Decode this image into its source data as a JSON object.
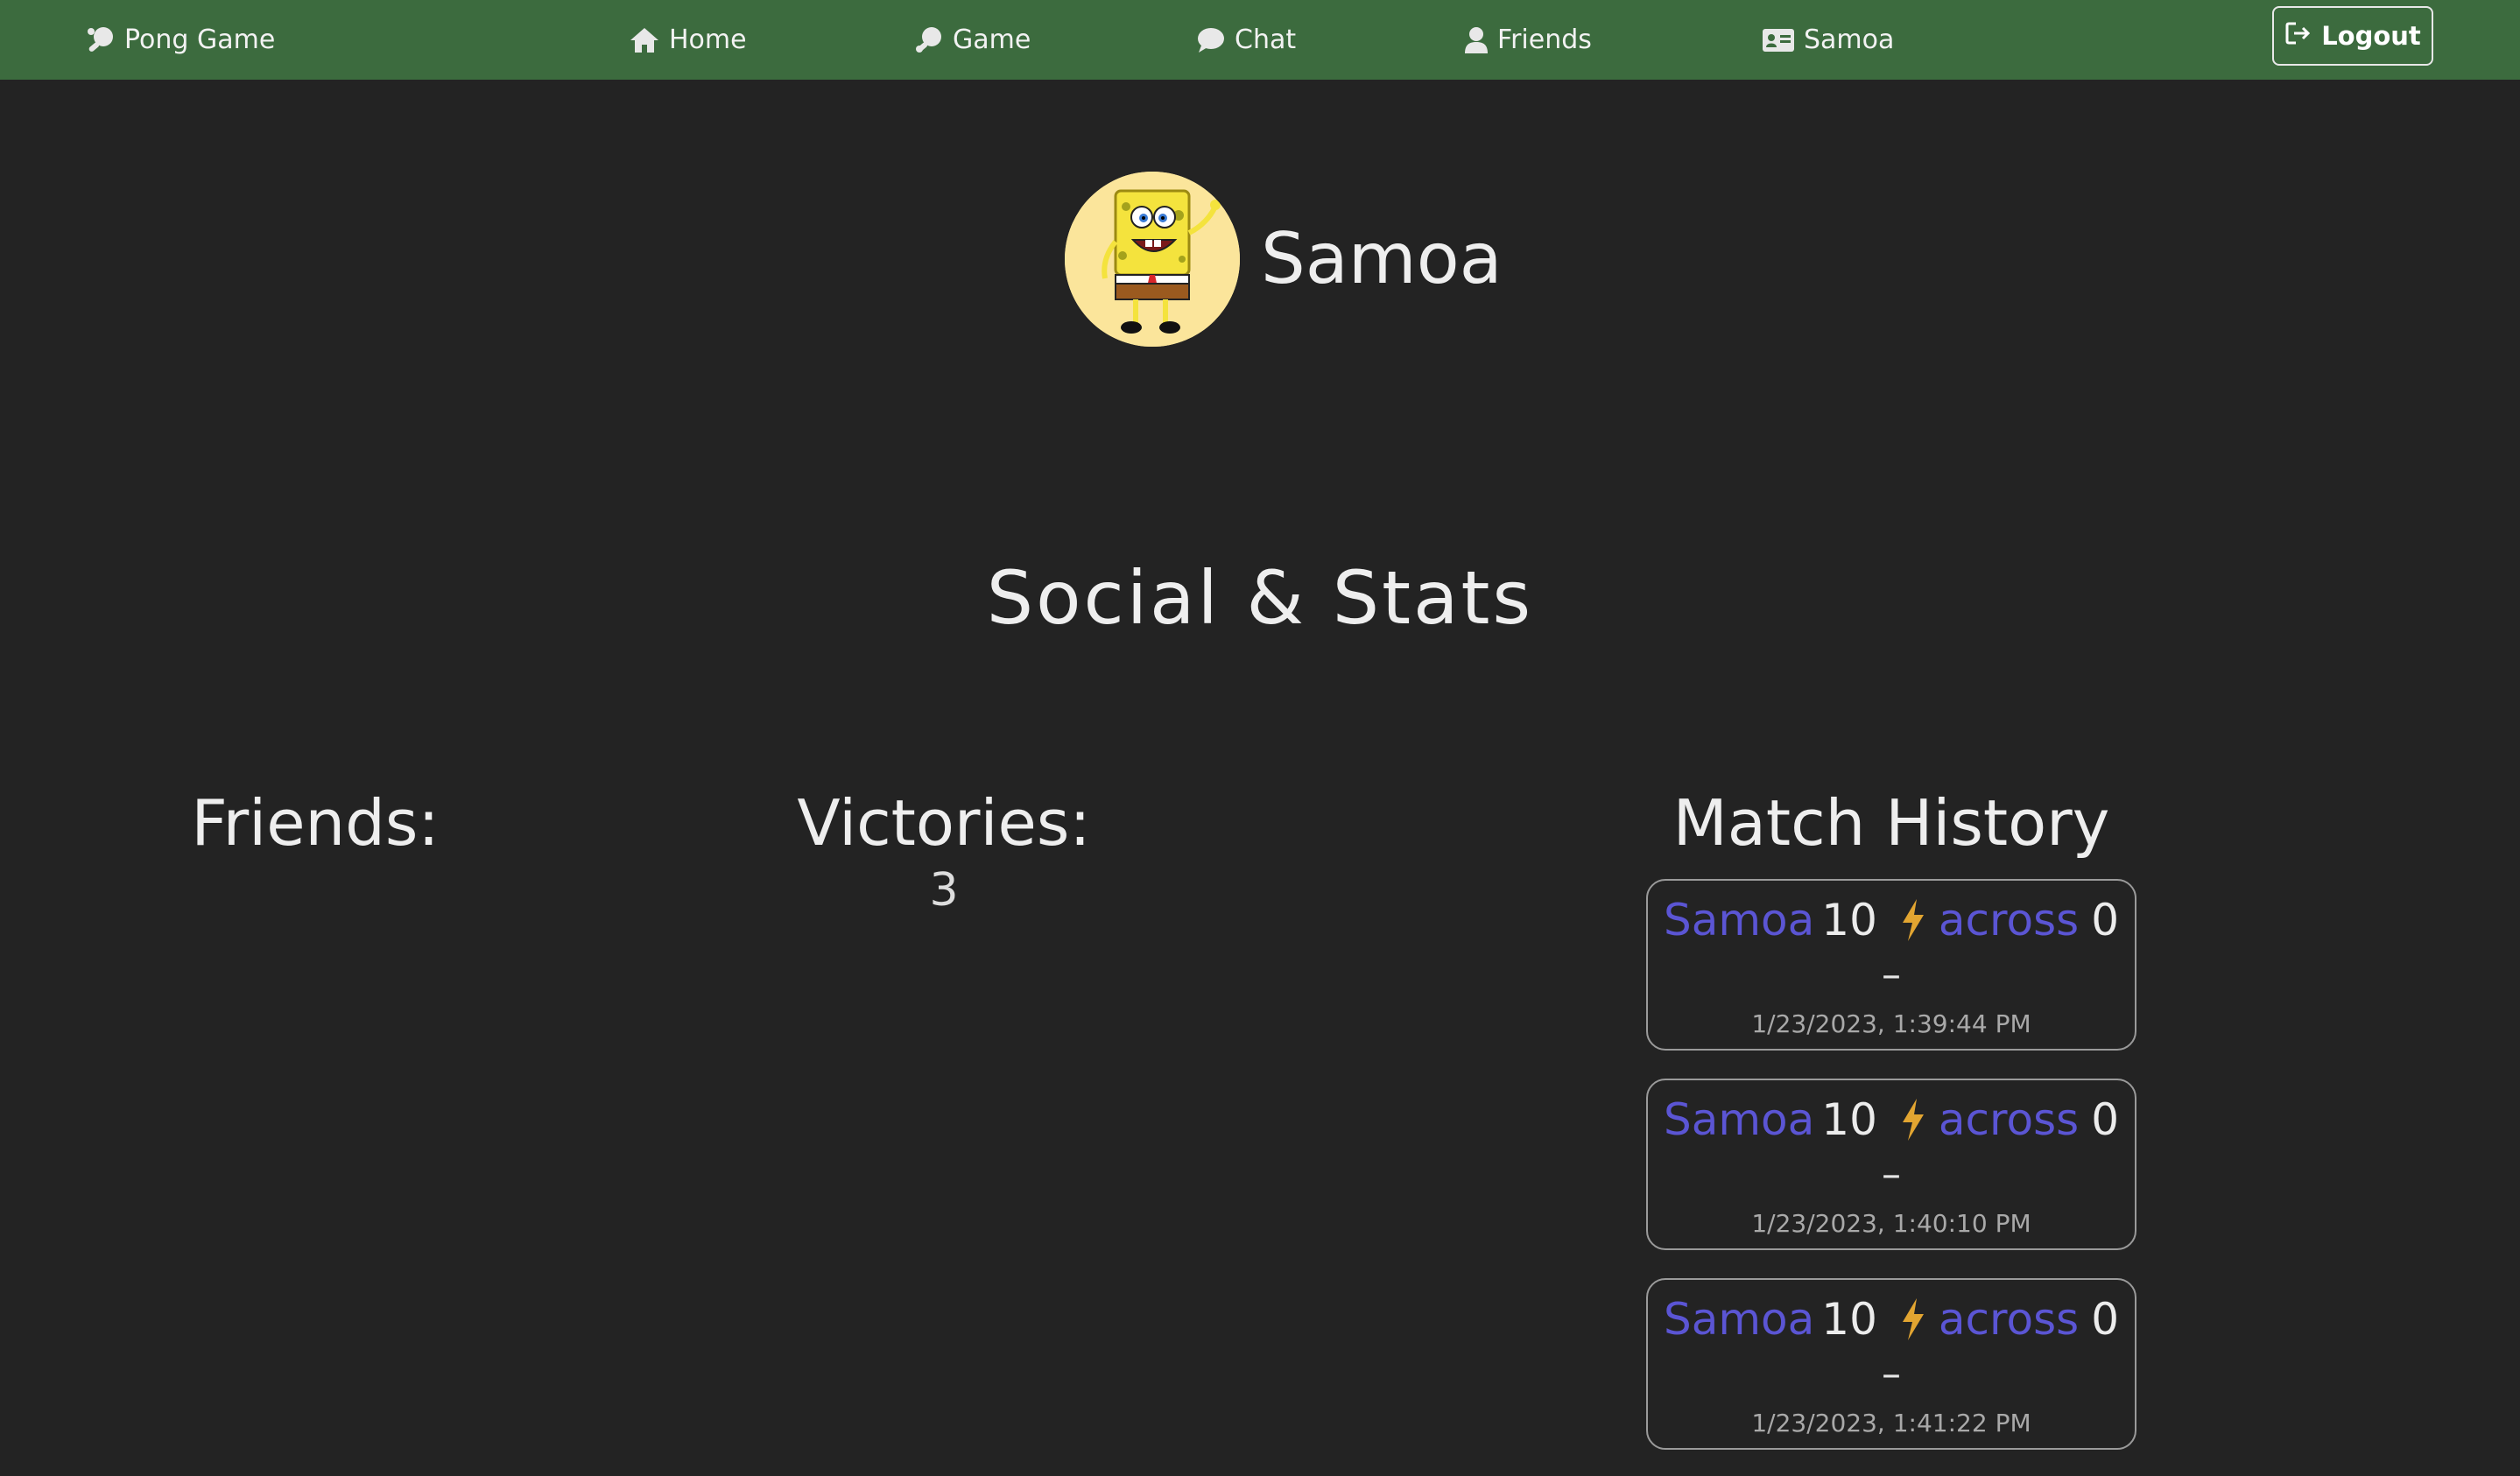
{
  "nav": {
    "brand": "Pong Game",
    "items": [
      {
        "label": "Home",
        "icon": "home-icon"
      },
      {
        "label": "Game",
        "icon": "ping-pong-icon"
      },
      {
        "label": "Chat",
        "icon": "chat-bubble-icon"
      },
      {
        "label": "Friends",
        "icon": "user-icon"
      },
      {
        "label": "Samoa",
        "icon": "id-card-icon"
      }
    ],
    "logout": "Logout"
  },
  "profile": {
    "username": "Samoa",
    "avatar": "spongebob-avatar"
  },
  "social": {
    "title": "Social & Stats",
    "friends_label": "Friends:",
    "victories_label": "Victories:",
    "victories_value": "3",
    "history_label": "Match History"
  },
  "matches": [
    {
      "player": "Samoa",
      "player_score": "10",
      "opponent": "across",
      "opponent_score": "0",
      "separator": "–",
      "date": "1/23/2023, 1:39:44 PM"
    },
    {
      "player": "Samoa",
      "player_score": "10",
      "opponent": "across",
      "opponent_score": "0",
      "separator": "–",
      "date": "1/23/2023, 1:40:10 PM"
    },
    {
      "player": "Samoa",
      "player_score": "10",
      "opponent": "across",
      "opponent_score": "0",
      "separator": "–",
      "date": "1/23/2023, 1:41:22 PM"
    }
  ],
  "colors": {
    "navbar": "#3c6b3e",
    "background": "#232323",
    "player_name": "#5b55d4",
    "lightning": "#e2a531",
    "avatar_bg": "#fbe59b"
  }
}
